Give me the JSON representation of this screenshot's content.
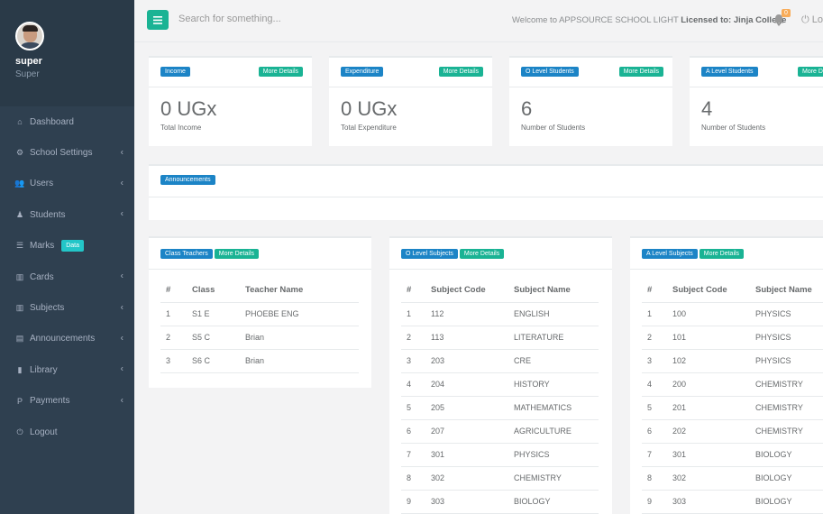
{
  "profile": {
    "name": "super",
    "role": "Super"
  },
  "nav": [
    {
      "label": "Dashboard",
      "icon": "home-icon",
      "chevron": false
    },
    {
      "label": "School Settings",
      "icon": "gear-icon",
      "chevron": true
    },
    {
      "label": "Users",
      "icon": "users-icon",
      "chevron": true
    },
    {
      "label": "Students",
      "icon": "user-icon",
      "chevron": true
    },
    {
      "label": "Marks",
      "icon": "list-icon",
      "chevron": false,
      "badge": "Data"
    },
    {
      "label": "Cards",
      "icon": "bar-chart-icon",
      "chevron": true
    },
    {
      "label": "Subjects",
      "icon": "bar-chart-icon",
      "chevron": true
    },
    {
      "label": "Announcements",
      "icon": "keyboard-icon",
      "chevron": true
    },
    {
      "label": "Library",
      "icon": "book-icon",
      "chevron": true
    },
    {
      "label": "Payments",
      "icon": "paypal-icon",
      "chevron": true
    },
    {
      "label": "Logout",
      "icon": "power-icon",
      "chevron": false
    }
  ],
  "topbar": {
    "search_placeholder": "Search for something...",
    "welcome_text": "Welcome to APPSOURCE SCHOOL LIGHT ",
    "license_text": "Licensed to: Jinja College",
    "notifications": "0",
    "logout_label": "Lo"
  },
  "stats": [
    {
      "title": "Income",
      "details": "More Details",
      "value": "0 UGx",
      "caption": "Total Income"
    },
    {
      "title": "Expenditure",
      "details": "More Details",
      "value": "0 UGx",
      "caption": "Total Expenditure"
    },
    {
      "title": "O Level Students",
      "details": "More Details",
      "value": "6",
      "caption": "Number of Students"
    },
    {
      "title": "A Level Students",
      "details": "More De",
      "value": "4",
      "caption": "Number of Students"
    }
  ],
  "announcements": {
    "title": "Announcements"
  },
  "class_teachers": {
    "title": "Class Teachers",
    "details": "More Details",
    "headers": [
      "#",
      "Class",
      "Teacher Name"
    ],
    "rows": [
      [
        "1",
        "S1 E",
        "PHOEBE ENG"
      ],
      [
        "2",
        "S5 C",
        "Brian"
      ],
      [
        "3",
        "S6 C",
        "Brian"
      ]
    ]
  },
  "o_level_subjects": {
    "title": "O Level Subjects",
    "details": "More Details",
    "headers": [
      "#",
      "Subject Code",
      "Subject Name"
    ],
    "rows": [
      [
        "1",
        "112",
        "ENGLISH"
      ],
      [
        "2",
        "113",
        "LITERATURE"
      ],
      [
        "3",
        "203",
        "CRE"
      ],
      [
        "4",
        "204",
        "HISTORY"
      ],
      [
        "5",
        "205",
        "MATHEMATICS"
      ],
      [
        "6",
        "207",
        "AGRICULTURE"
      ],
      [
        "7",
        "301",
        "PHYSICS"
      ],
      [
        "8",
        "302",
        "CHEMISTRY"
      ],
      [
        "9",
        "303",
        "BIOLOGY"
      ]
    ]
  },
  "a_level_subjects": {
    "title": "A Level Subjects",
    "details": "More Details",
    "headers": [
      "#",
      "Subject Code",
      "Subject Name"
    ],
    "rows": [
      [
        "1",
        "100",
        "PHYSICS"
      ],
      [
        "2",
        "101",
        "PHYSICS"
      ],
      [
        "3",
        "102",
        "PHYSICS"
      ],
      [
        "4",
        "200",
        "CHEMISTRY"
      ],
      [
        "5",
        "201",
        "CHEMISTRY"
      ],
      [
        "6",
        "202",
        "CHEMISTRY"
      ],
      [
        "7",
        "301",
        "BIOLOGY"
      ],
      [
        "8",
        "302",
        "BIOLOGY"
      ],
      [
        "9",
        "303",
        "BIOLOGY"
      ]
    ]
  },
  "colors": {
    "sidebar": "#2f4050",
    "primary": "#1ab394",
    "info": "#1c84c6",
    "warning": "#f8ac59",
    "teal": "#23c6c8"
  }
}
